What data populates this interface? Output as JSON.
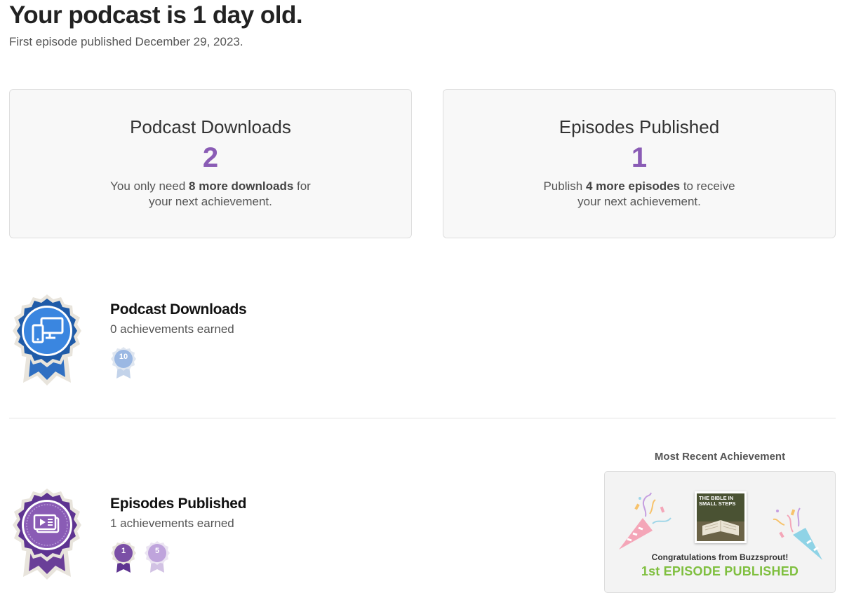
{
  "header": {
    "title": "Your podcast is 1 day old.",
    "subtitle": "First episode published December 29, 2023."
  },
  "stats": {
    "downloads": {
      "title": "Podcast Downloads",
      "value": "2",
      "note_before": "You only need ",
      "note_bold": "8 more downloads",
      "note_after_line1": " for",
      "note_line2": "your next achievement."
    },
    "episodes": {
      "title": "Episodes Published",
      "value": "1",
      "note_before": "Publish ",
      "note_bold": "4 more episodes",
      "note_after_line1": " to receive",
      "note_line2": "your next achievement."
    }
  },
  "achievements": {
    "downloads": {
      "title": "Podcast Downloads",
      "count": "0 achievements earned",
      "badges": [
        "10"
      ],
      "icon": "devices-icon",
      "color": "#3a7bd5"
    },
    "episodes": {
      "title": "Episodes Published",
      "count": "1 achievements earned",
      "badges": [
        "1",
        "5"
      ],
      "icon": "episodes-icon",
      "color": "#7b4fa6"
    }
  },
  "recent": {
    "heading": "Most Recent Achievement",
    "cover_title": "THE BIBLE IN SMALL STEPS",
    "congrats": "Congratulations from Buzzsprout!",
    "milestone": "1st EPISODE PUBLISHED"
  },
  "colors": {
    "accent_purple": "#8a5cb5",
    "badge_blue": "#3a7bd5",
    "badge_purple": "#7b4fa6",
    "milestone_green": "#7fbf3f"
  }
}
